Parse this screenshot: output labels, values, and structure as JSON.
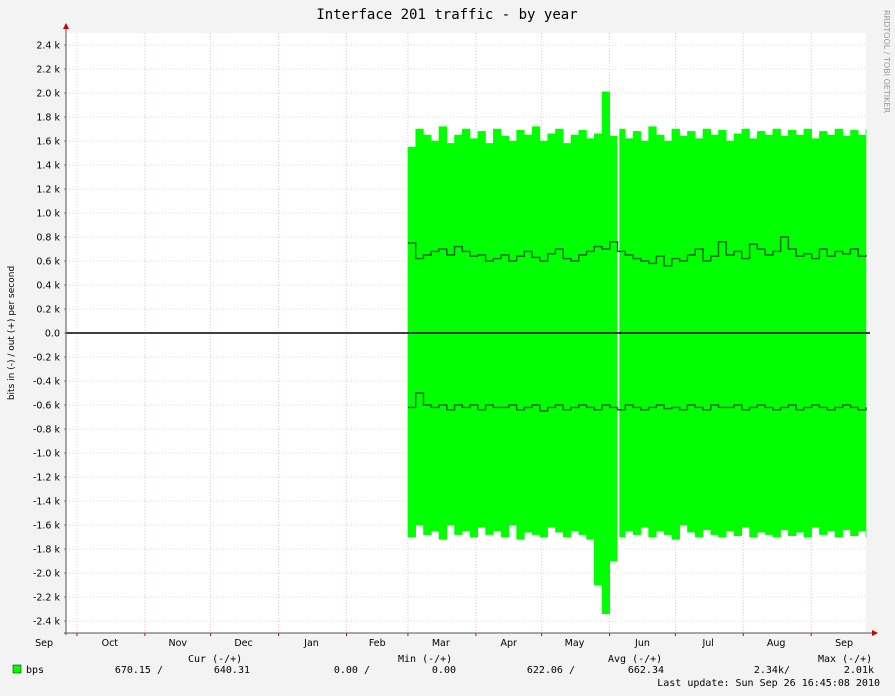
{
  "title": "Interface 201 traffic - by year",
  "vertical_credit": "RRDTOOL / TOBI OETIKER",
  "colors": {
    "background": "#f3f3f3",
    "plot_bg": "#ffffff",
    "area": "#00ff00",
    "avg_line": "#006600",
    "grid": "#e6a8a8",
    "zero_line": "#000000",
    "text": "#000000"
  },
  "legend": {
    "swatch_color": "#00ff00",
    "name": "bps",
    "headers": {
      "cur": "Cur (-/+)",
      "min": "Min (-/+)",
      "avg": "Avg (-/+)",
      "max": "Max (-/+)"
    },
    "cur": {
      "in": "670.15 /",
      "out": "640.31"
    },
    "min": {
      "in": "0.00 /",
      "out": "0.00"
    },
    "avg": {
      "in": "622.06 /",
      "out": "662.34"
    },
    "max": {
      "in": "2.34k/",
      "out": "2.01k"
    },
    "last_update": "Last update: Sun Sep 26 16:45:08 2010"
  },
  "chart_data": {
    "type": "area",
    "title": "Interface 201 traffic - by year",
    "ylabel": "bits in (-) / out (+) per second",
    "ylim": [
      -2500,
      2500
    ],
    "y_ticks": [
      2400,
      2200,
      2000,
      1800,
      1600,
      1400,
      1200,
      1000,
      800,
      600,
      400,
      200,
      0,
      -200,
      -400,
      -600,
      -800,
      -1000,
      -1200,
      -1400,
      -1600,
      -1800,
      -2000,
      -2200,
      -2400
    ],
    "y_tick_labels": [
      "2.4 k",
      "2.2 k",
      "2.0 k",
      "1.8 k",
      "1.6 k",
      "1.4 k",
      "1.2 k",
      "1.0 k",
      "0.8 k",
      "0.6 k",
      "0.4 k",
      "0.2 k",
      "0.0",
      "-0.2 k",
      "-0.4 k",
      "-0.6 k",
      "-0.8 k",
      "-1.0 k",
      "-1.2 k",
      "-1.4 k",
      "-1.6 k",
      "-1.8 k",
      "-2.0 k",
      "-2.2 k",
      "-2.4 k"
    ],
    "x_range": [
      "2009-09-26",
      "2010-09-26"
    ],
    "x_tick_labels": [
      "Sep",
      "Oct",
      "Nov",
      "Dec",
      "Jan",
      "Feb",
      "Mar",
      "Apr",
      "May",
      "Jun",
      "Jul",
      "Aug",
      "Sep"
    ],
    "x_label_dates": [
      "2009-09-16",
      "2009-10-16",
      "2009-11-16",
      "2009-12-16",
      "2010-01-16",
      "2010-02-15",
      "2010-03-16",
      "2010-04-16",
      "2010-05-16",
      "2010-06-16",
      "2010-07-16",
      "2010-08-16",
      "2010-09-16"
    ],
    "x_grid_dates": [
      "2009-10-01",
      "2009-11-01",
      "2009-12-01",
      "2010-01-01",
      "2010-02-01",
      "2010-03-01",
      "2010-04-01",
      "2010-05-01",
      "2010-06-01",
      "2010-07-01",
      "2010-08-01",
      "2010-09-01"
    ],
    "grid": true,
    "data_start": "2010-03-01",
    "gap_date": "2010-06-05",
    "series": [
      {
        "name": "out (+) max",
        "values": [
          1550,
          1700,
          1650,
          1600,
          1720,
          1580,
          1650,
          1700,
          1620,
          1680,
          1580,
          1700,
          1640,
          1600,
          1690,
          1650,
          1720,
          1600,
          1660,
          1700,
          1580,
          1650,
          1690,
          1620,
          1660,
          2010,
          1640,
          1700,
          1620,
          1680,
          1600,
          1720,
          1650,
          1600,
          1700,
          1640,
          1680,
          1620,
          1700,
          1650,
          1690,
          1600,
          1660,
          1700,
          1620,
          1680,
          1650,
          1700,
          1640,
          1690,
          1650,
          1700,
          1620,
          1680,
          1650,
          1700,
          1640,
          1690,
          1650,
          1700
        ]
      },
      {
        "name": "out (+) avg",
        "values": [
          750,
          620,
          650,
          680,
          700,
          650,
          720,
          680,
          640,
          650,
          600,
          620,
          650,
          600,
          640,
          680,
          630,
          600,
          660,
          700,
          620,
          600,
          650,
          680,
          720,
          700,
          760,
          680,
          650,
          620,
          600,
          580,
          640,
          560,
          620,
          600,
          650,
          700,
          600,
          640,
          760,
          650,
          680,
          620,
          740,
          700,
          650,
          680,
          800,
          700,
          640,
          660,
          620,
          700,
          640,
          680,
          660,
          700,
          640,
          650
        ]
      },
      {
        "name": "in (-) max",
        "values": [
          -1700,
          -1600,
          -1680,
          -1650,
          -1720,
          -1600,
          -1680,
          -1650,
          -1700,
          -1620,
          -1680,
          -1650,
          -1700,
          -1600,
          -1720,
          -1660,
          -1680,
          -1700,
          -1620,
          -1660,
          -1700,
          -1650,
          -1680,
          -1720,
          -2100,
          -2340,
          -1900,
          -1700,
          -1650,
          -1680,
          -1620,
          -1700,
          -1650,
          -1680,
          -1720,
          -1600,
          -1660,
          -1700,
          -1640,
          -1680,
          -1700,
          -1650,
          -1690,
          -1620,
          -1700,
          -1660,
          -1680,
          -1700,
          -1640,
          -1690,
          -1660,
          -1700,
          -1620,
          -1680,
          -1650,
          -1700,
          -1640,
          -1690,
          -1650,
          -1700
        ]
      },
      {
        "name": "in (-) avg",
        "values": [
          -620,
          -500,
          -600,
          -620,
          -600,
          -640,
          -600,
          -620,
          -600,
          -640,
          -600,
          -620,
          -620,
          -600,
          -640,
          -620,
          -600,
          -650,
          -620,
          -600,
          -640,
          -620,
          -600,
          -620,
          -640,
          -600,
          -620,
          -640,
          -600,
          -620,
          -640,
          -620,
          -600,
          -630,
          -620,
          -640,
          -600,
          -620,
          -640,
          -600,
          -620,
          -620,
          -600,
          -640,
          -620,
          -600,
          -620,
          -640,
          -620,
          -600,
          -640,
          -620,
          -600,
          -620,
          -640,
          -620,
          -600,
          -620,
          -640,
          -620
        ]
      }
    ]
  }
}
